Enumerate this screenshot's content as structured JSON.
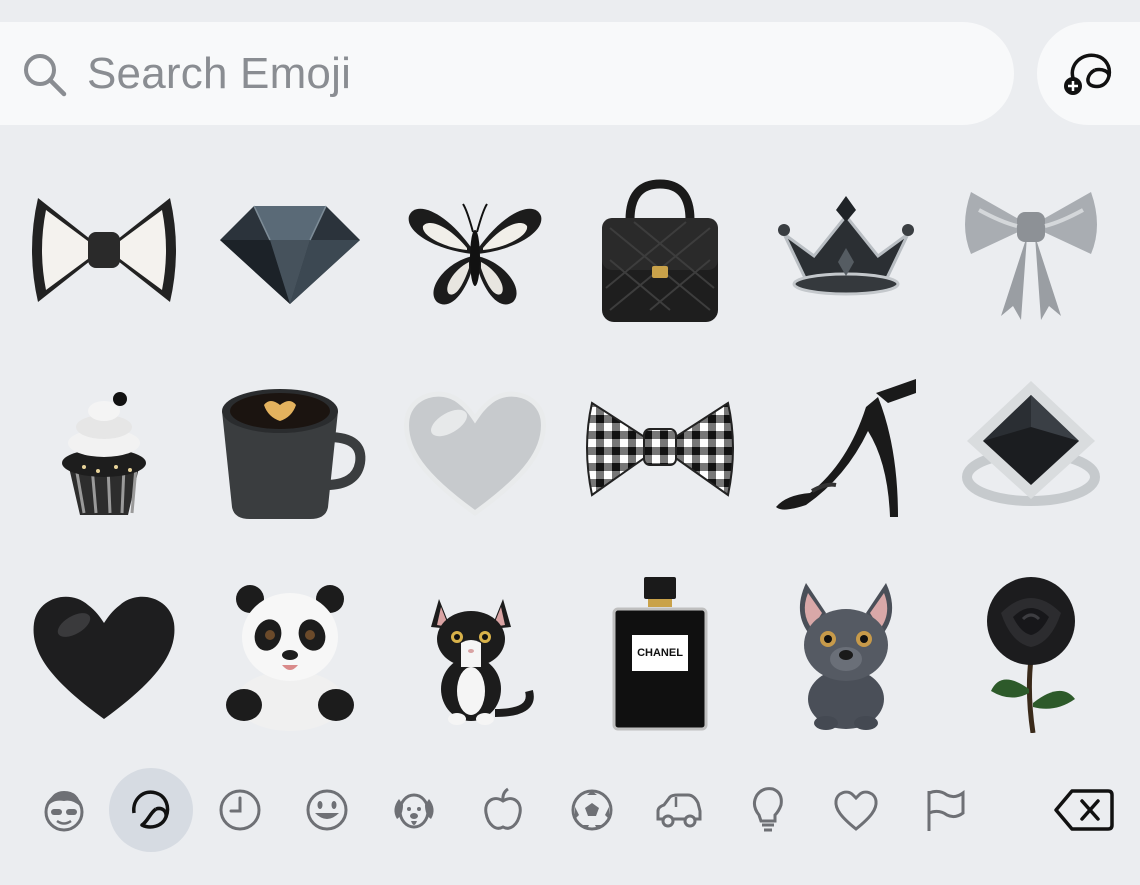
{
  "search": {
    "placeholder": "Search Emoji",
    "icon": "search-icon"
  },
  "sticker_button": {
    "icon": "add-sticker-icon"
  },
  "emoji_grid": [
    {
      "name": "bow-tie-white"
    },
    {
      "name": "diamond"
    },
    {
      "name": "butterfly"
    },
    {
      "name": "handbag"
    },
    {
      "name": "crown"
    },
    {
      "name": "silver-bow"
    },
    {
      "name": "cupcake"
    },
    {
      "name": "coffee-cup"
    },
    {
      "name": "silver-heart"
    },
    {
      "name": "gingham-bow"
    },
    {
      "name": "high-heel"
    },
    {
      "name": "ring"
    },
    {
      "name": "black-heart"
    },
    {
      "name": "panda"
    },
    {
      "name": "cat"
    },
    {
      "name": "perfume"
    },
    {
      "name": "french-bulldog"
    },
    {
      "name": "black-rose"
    }
  ],
  "perfume_label": {
    "line1": "CHANEL"
  },
  "category_bar": [
    {
      "name": "memoji-icon"
    },
    {
      "name": "stickers-icon",
      "active": true
    },
    {
      "name": "recent-icon"
    },
    {
      "name": "smileys-icon"
    },
    {
      "name": "animals-icon"
    },
    {
      "name": "food-icon"
    },
    {
      "name": "activity-icon"
    },
    {
      "name": "travel-icon"
    },
    {
      "name": "objects-icon"
    },
    {
      "name": "symbols-icon"
    },
    {
      "name": "flags-icon"
    },
    {
      "name": "delete-icon"
    }
  ],
  "colors": {
    "background": "#ebedf0",
    "search_bg": "#f8f9fa",
    "active_tab": "#d6dbe2",
    "icon_gray": "#6e7075"
  }
}
